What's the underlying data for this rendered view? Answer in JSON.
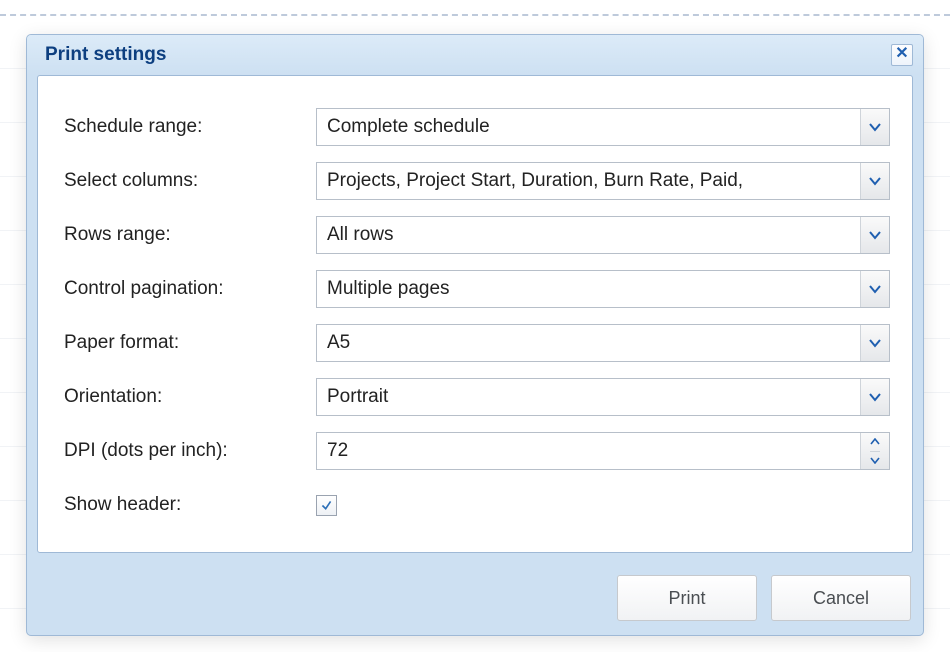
{
  "dialog": {
    "title": "Print settings"
  },
  "fields": {
    "schedule_range": {
      "label": "Schedule range:",
      "value": "Complete schedule"
    },
    "columns": {
      "label": "Select columns:",
      "value": "Projects, Project Start, Duration, Burn Rate, Paid,"
    },
    "rows_range": {
      "label": "Rows range:",
      "value": "All rows"
    },
    "pagination": {
      "label": "Control pagination:",
      "value": "Multiple pages"
    },
    "paper": {
      "label": "Paper format:",
      "value": "A5"
    },
    "orientation": {
      "label": "Orientation:",
      "value": "Portrait"
    },
    "dpi": {
      "label": "DPI (dots per inch):",
      "value": "72"
    },
    "show_header": {
      "label": "Show header:",
      "checked": true
    }
  },
  "buttons": {
    "print": "Print",
    "cancel": "Cancel"
  },
  "colors": {
    "title": "#0d3f80",
    "dialog_bg": "#cde0f2",
    "chevron": "#1f5fb0",
    "check": "#2b6fb7"
  }
}
